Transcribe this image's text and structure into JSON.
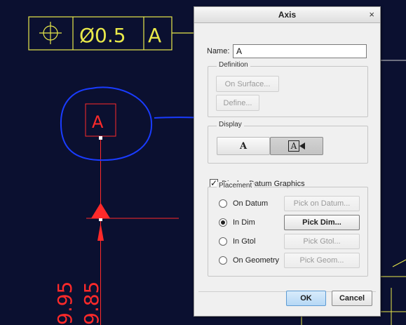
{
  "cad": {
    "fcf_symbol": "⌖",
    "fcf_tolerance": "Ø0.5",
    "fcf_datum": "A",
    "datum_tag": "A",
    "dim_1": "9.95",
    "dim_2": "9.85",
    "colors": {
      "background": "#0b1030",
      "frame": "#e8e84a",
      "datum": "#ff2a2a",
      "annotation": "#1a3cff"
    }
  },
  "dialog": {
    "title": "Axis",
    "close_icon": "×",
    "name_label": "Name:",
    "name_value": "A",
    "definition": {
      "title": "Definition",
      "on_surface": "On Surface...",
      "define": "Define..."
    },
    "display": {
      "title": "Display",
      "option_plain": "A",
      "option_tag": "A"
    },
    "display_datum_graphics": {
      "label": "Display Datum Graphics",
      "checked": true
    },
    "placement": {
      "title": "Placement",
      "options": [
        {
          "label": "On Datum",
          "button": "Pick on Datum...",
          "selected": false
        },
        {
          "label": "In Dim",
          "button": "Pick Dim...",
          "selected": true
        },
        {
          "label": "In Gtol",
          "button": "Pick Gtol...",
          "selected": false
        },
        {
          "label": "On Geometry",
          "button": "Pick Geom...",
          "selected": false
        }
      ]
    },
    "ok": "OK",
    "cancel": "Cancel"
  }
}
